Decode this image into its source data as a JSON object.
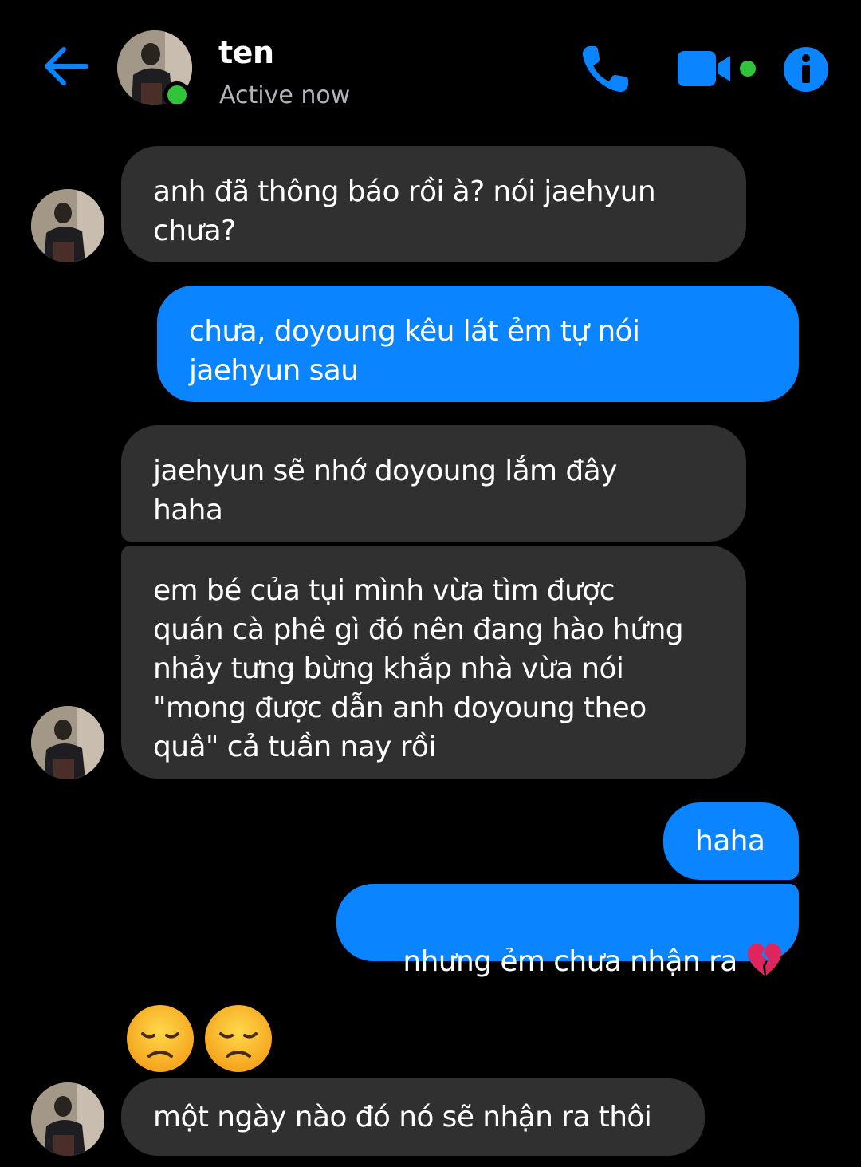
{
  "header": {
    "contact_name": "ten",
    "status": "Active now",
    "icons": {
      "back": "back-arrow-icon",
      "call": "phone-icon",
      "video": "video-camera-icon",
      "info": "info-icon"
    },
    "accent_color": "#0a84ff",
    "online_color": "#31c33a"
  },
  "messages": [
    {
      "direction": "incoming",
      "text": "anh đã thông báo rồi à? nói jaehyun\nchưa?"
    },
    {
      "direction": "outgoing",
      "text": "chưa, doyoung kêu lát ẻm tự nói\njaehyun sau"
    },
    {
      "direction": "incoming",
      "text": "jaehyun sẽ nhớ doyoung lắm đây\nhaha"
    },
    {
      "direction": "incoming",
      "text": "em bé của tụi mình vừa tìm được\nquán cà phê gì đó nên đang hào hứng\nnhảy tưng bừng khắp nhà vừa nói\n\"mong được dẫn anh doyoung theo\nquâ\" cả tuần nay rồi"
    },
    {
      "direction": "outgoing",
      "text": "haha"
    },
    {
      "direction": "outgoing",
      "text": "nhưng ẻm chưa nhận ra ",
      "emoji": "broken-heart-icon"
    },
    {
      "direction": "incoming",
      "emoji_only": [
        "disappointed-face-icon",
        "disappointed-face-icon"
      ]
    },
    {
      "direction": "incoming",
      "text": "một ngày nào đó nó sẽ nhận ra thôi"
    }
  ],
  "colors": {
    "incoming_bubble": "#303030",
    "outgoing_bubble": "#0a84ff",
    "background": "#000000"
  }
}
